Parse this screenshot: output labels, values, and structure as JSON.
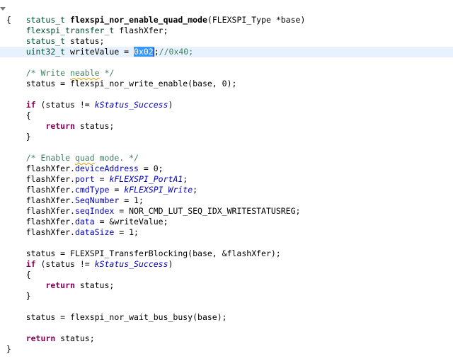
{
  "code": {
    "signature": {
      "ret_type": "status_t",
      "fn_name": "flexspi_nor_enable_quad_mode",
      "params": "(FLEXSPI_Type *base)"
    },
    "open_brace": "{",
    "close_brace": "}",
    "decl_transfer": {
      "type": "flexspi_transfer_t",
      "name": " flashXfer;"
    },
    "decl_status": {
      "type": "status_t",
      "name": " status;"
    },
    "decl_write": {
      "type": "uint32_t",
      "before": " writeValue = ",
      "selected": "0x02",
      "after_caret": ";",
      "comment": "//0x40;"
    },
    "comment_write_enable": {
      "start": "/* Write ",
      "misspelled": "neable",
      "end": " */"
    },
    "stmt_write_enable": "status = flexspi_nor_write_enable(base, 0);",
    "if1": {
      "keyword": "if",
      "condition": " (status != ",
      "enum": "kStatus_Success",
      "close": ")"
    },
    "block1_open": "{",
    "return1": {
      "keyword": "return",
      "rest": " status;"
    },
    "block1_close": "}",
    "comment_quad": {
      "start": "/* Enable ",
      "misspelled": "quad",
      "end": " mode. */"
    },
    "assign_device_address": {
      "obj": "flashXfer.",
      "field": "deviceAddress",
      "rest": " = 0;"
    },
    "assign_port": {
      "obj": "flashXfer.",
      "field": "port",
      "eq": " = ",
      "enum": "kFLEXSPI_PortA1",
      "end": ";"
    },
    "assign_cmd_type": {
      "obj": "flashXfer.",
      "field": "cmdType",
      "eq": " = ",
      "enum": "kFLEXSPI_Write",
      "end": ";"
    },
    "assign_seq_number": {
      "obj": "flashXfer.",
      "field": "SeqNumber",
      "rest": " = 1;"
    },
    "assign_seq_index": {
      "obj": "flashXfer.",
      "field": "seqIndex",
      "rest": " = NOR_CMD_LUT_SEQ_IDX_WRITESTATUSREG;"
    },
    "assign_data": {
      "obj": "flashXfer.",
      "field": "data",
      "rest": " = &writeValue;"
    },
    "assign_data_size": {
      "obj": "flashXfer.",
      "field": "dataSize",
      "rest": " = 1;"
    },
    "stmt_transfer": "status = FLEXSPI_TransferBlocking(base, &flashXfer);",
    "if2": {
      "keyword": "if",
      "condition": " (status != ",
      "enum": "kStatus_Success",
      "close": ")"
    },
    "block2_open": "{",
    "return2": {
      "keyword": "return",
      "rest": " status;"
    },
    "block2_close": "}",
    "stmt_wait": "status = flexspi_nor_wait_bus_busy(base);",
    "return3": {
      "keyword": "return",
      "rest": " status;"
    }
  },
  "colors": {
    "keyword": "#7f0055",
    "type": "#005032",
    "field": "#0000c0",
    "comment": "#3f7f5f",
    "selection": "#3399ff",
    "current_line": "#e8f2fe"
  }
}
